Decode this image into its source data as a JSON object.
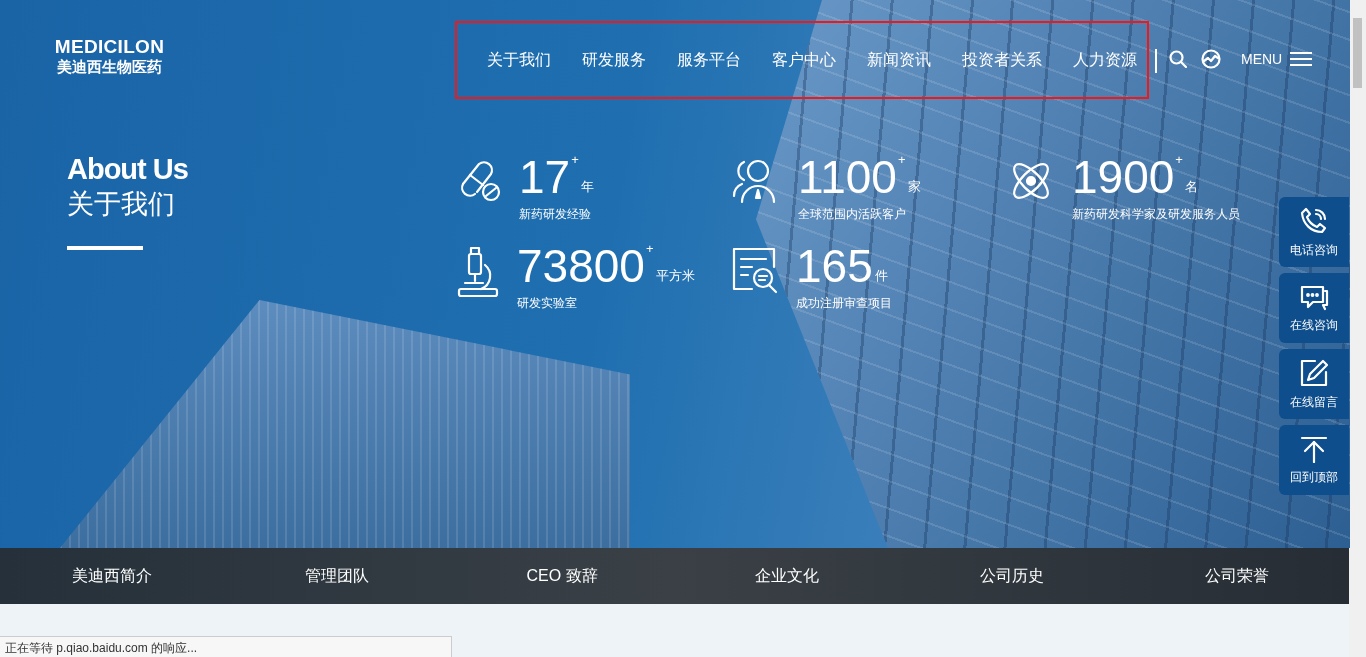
{
  "header": {
    "logo": {
      "title": "MEDICILON",
      "subtitle": "美迪西生物医药"
    },
    "nav": [
      {
        "label": "关于我们"
      },
      {
        "label": "研发服务"
      },
      {
        "label": "服务平台"
      },
      {
        "label": "客户中心"
      },
      {
        "label": "新闻资讯"
      },
      {
        "label": "投资者关系"
      },
      {
        "label": "人力资源"
      }
    ],
    "nav_highlighted": true,
    "menu_label": "MENU"
  },
  "hero": {
    "title": "About Us",
    "subtitle": "关于我们",
    "stats": [
      {
        "kind": "pill",
        "value": "17",
        "plus": "+",
        "unit": "年",
        "label": "新药研发经验"
      },
      {
        "kind": "people",
        "value": "1100",
        "plus": "+",
        "unit": "家",
        "label": "全球范围内活跃客户"
      },
      {
        "kind": "atom",
        "value": "1900",
        "plus": "+",
        "unit": "名",
        "label": "新药研发科学家及研发服务人员"
      },
      {
        "kind": "microscope",
        "value": "73800",
        "plus": "+",
        "unit": "平方米",
        "label": "研发实验室"
      },
      {
        "kind": "document",
        "value": "165",
        "unit": "件",
        "label": "成功注册审查项目"
      }
    ]
  },
  "side_tools": [
    {
      "kind": "phone",
      "label": "电话咨询"
    },
    {
      "kind": "chat",
      "label": "在线咨询"
    },
    {
      "kind": "edit",
      "label": "在线留言"
    },
    {
      "kind": "top",
      "label": "回到顶部"
    }
  ],
  "sub_nav": [
    {
      "label": "美迪西简介"
    },
    {
      "label": "管理团队"
    },
    {
      "label": "CEO 致辞"
    },
    {
      "label": "企业文化"
    },
    {
      "label": "公司历史"
    },
    {
      "label": "公司荣誉"
    }
  ],
  "status_bar": "正在等待 p.qiao.baidu.com 的响应..."
}
